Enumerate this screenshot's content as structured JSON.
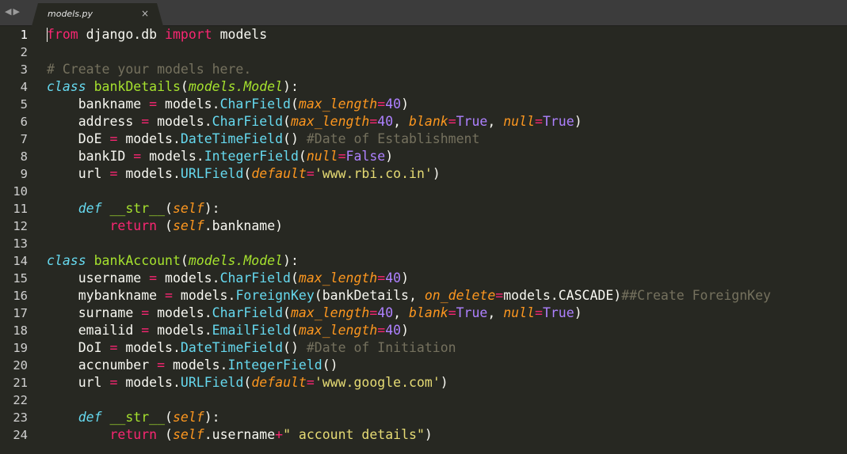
{
  "tabbar": {
    "back_arrow": "◀",
    "forward_arrow": "▶",
    "tab_title": "models.py",
    "close_glyph": "×"
  },
  "editor": {
    "current_line": 1,
    "lines": [
      [
        [
          "kw",
          "from"
        ],
        [
          "pl",
          " django.db "
        ],
        [
          "kw",
          "import"
        ],
        [
          "pl",
          " models"
        ]
      ],
      [],
      [
        [
          "cm",
          "# Create your models here."
        ]
      ],
      [
        [
          "st",
          "class"
        ],
        [
          "pl",
          " "
        ],
        [
          "cl",
          "bankDetails"
        ],
        [
          "pl",
          "("
        ],
        [
          "ih",
          "models.Model"
        ],
        [
          "pl",
          "):"
        ]
      ],
      [
        [
          "pl",
          "    bankname "
        ],
        [
          "op",
          "="
        ],
        [
          "pl",
          " models."
        ],
        [
          "fn",
          "CharField"
        ],
        [
          "pl",
          "("
        ],
        [
          "pa",
          "max_length"
        ],
        [
          "op",
          "="
        ],
        [
          "nu",
          "40"
        ],
        [
          "pl",
          ")"
        ]
      ],
      [
        [
          "pl",
          "    address "
        ],
        [
          "op",
          "="
        ],
        [
          "pl",
          " models."
        ],
        [
          "fn",
          "CharField"
        ],
        [
          "pl",
          "("
        ],
        [
          "pa",
          "max_length"
        ],
        [
          "op",
          "="
        ],
        [
          "nu",
          "40"
        ],
        [
          "pl",
          ", "
        ],
        [
          "pa",
          "blank"
        ],
        [
          "op",
          "="
        ],
        [
          "bi",
          "True"
        ],
        [
          "pl",
          ", "
        ],
        [
          "pa",
          "null"
        ],
        [
          "op",
          "="
        ],
        [
          "bi",
          "True"
        ],
        [
          "pl",
          ")"
        ]
      ],
      [
        [
          "pl",
          "    DoE "
        ],
        [
          "op",
          "="
        ],
        [
          "pl",
          " models."
        ],
        [
          "fn",
          "DateTimeField"
        ],
        [
          "pl",
          "() "
        ],
        [
          "cm",
          "#Date of Establishment"
        ]
      ],
      [
        [
          "pl",
          "    bankID "
        ],
        [
          "op",
          "="
        ],
        [
          "pl",
          " models."
        ],
        [
          "fn",
          "IntegerField"
        ],
        [
          "pl",
          "("
        ],
        [
          "pa",
          "null"
        ],
        [
          "op",
          "="
        ],
        [
          "bi",
          "False"
        ],
        [
          "pl",
          ")"
        ]
      ],
      [
        [
          "pl",
          "    url "
        ],
        [
          "op",
          "="
        ],
        [
          "pl",
          " models."
        ],
        [
          "fn",
          "URLField"
        ],
        [
          "pl",
          "("
        ],
        [
          "pa",
          "default"
        ],
        [
          "op",
          "="
        ],
        [
          "s",
          "'www.rbi.co.in'"
        ],
        [
          "pl",
          ")"
        ]
      ],
      [],
      [
        [
          "pl",
          "    "
        ],
        [
          "st",
          "def"
        ],
        [
          "pl",
          " "
        ],
        [
          "dn",
          "__str__"
        ],
        [
          "pl",
          "("
        ],
        [
          "sf",
          "self"
        ],
        [
          "pl",
          "):"
        ]
      ],
      [
        [
          "pl",
          "        "
        ],
        [
          "kw",
          "return"
        ],
        [
          "pl",
          " ("
        ],
        [
          "sf",
          "self"
        ],
        [
          "pl",
          ".bankname)"
        ]
      ],
      [],
      [
        [
          "st",
          "class"
        ],
        [
          "pl",
          " "
        ],
        [
          "cl",
          "bankAccount"
        ],
        [
          "pl",
          "("
        ],
        [
          "ih",
          "models.Model"
        ],
        [
          "pl",
          "):"
        ]
      ],
      [
        [
          "pl",
          "    username "
        ],
        [
          "op",
          "="
        ],
        [
          "pl",
          " models."
        ],
        [
          "fn",
          "CharField"
        ],
        [
          "pl",
          "("
        ],
        [
          "pa",
          "max_length"
        ],
        [
          "op",
          "="
        ],
        [
          "nu",
          "40"
        ],
        [
          "pl",
          ")"
        ]
      ],
      [
        [
          "pl",
          "    mybankname "
        ],
        [
          "op",
          "="
        ],
        [
          "pl",
          " models."
        ],
        [
          "fn",
          "ForeignKey"
        ],
        [
          "pl",
          "(bankDetails, "
        ],
        [
          "pa",
          "on_delete"
        ],
        [
          "op",
          "="
        ],
        [
          "pl",
          "models.CASCADE)"
        ],
        [
          "cm",
          "##Create ForeignKey"
        ]
      ],
      [
        [
          "pl",
          "    surname "
        ],
        [
          "op",
          "="
        ],
        [
          "pl",
          " models."
        ],
        [
          "fn",
          "CharField"
        ],
        [
          "pl",
          "("
        ],
        [
          "pa",
          "max_length"
        ],
        [
          "op",
          "="
        ],
        [
          "nu",
          "40"
        ],
        [
          "pl",
          ", "
        ],
        [
          "pa",
          "blank"
        ],
        [
          "op",
          "="
        ],
        [
          "bi",
          "True"
        ],
        [
          "pl",
          ", "
        ],
        [
          "pa",
          "null"
        ],
        [
          "op",
          "="
        ],
        [
          "bi",
          "True"
        ],
        [
          "pl",
          ")"
        ]
      ],
      [
        [
          "pl",
          "    emailid "
        ],
        [
          "op",
          "="
        ],
        [
          "pl",
          " models."
        ],
        [
          "fn",
          "EmailField"
        ],
        [
          "pl",
          "("
        ],
        [
          "pa",
          "max_length"
        ],
        [
          "op",
          "="
        ],
        [
          "nu",
          "40"
        ],
        [
          "pl",
          ")"
        ]
      ],
      [
        [
          "pl",
          "    DoI "
        ],
        [
          "op",
          "="
        ],
        [
          "pl",
          " models."
        ],
        [
          "fn",
          "DateTimeField"
        ],
        [
          "pl",
          "() "
        ],
        [
          "cm",
          "#Date of Initiation"
        ]
      ],
      [
        [
          "pl",
          "    accnumber "
        ],
        [
          "op",
          "="
        ],
        [
          "pl",
          " models."
        ],
        [
          "fn",
          "IntegerField"
        ],
        [
          "pl",
          "()"
        ]
      ],
      [
        [
          "pl",
          "    url "
        ],
        [
          "op",
          "="
        ],
        [
          "pl",
          " models."
        ],
        [
          "fn",
          "URLField"
        ],
        [
          "pl",
          "("
        ],
        [
          "pa",
          "default"
        ],
        [
          "op",
          "="
        ],
        [
          "s",
          "'www.google.com'"
        ],
        [
          "pl",
          ")"
        ]
      ],
      [],
      [
        [
          "pl",
          "    "
        ],
        [
          "st",
          "def"
        ],
        [
          "pl",
          " "
        ],
        [
          "dn",
          "__str__"
        ],
        [
          "pl",
          "("
        ],
        [
          "sf",
          "self"
        ],
        [
          "pl",
          "):"
        ]
      ],
      [
        [
          "pl",
          "        "
        ],
        [
          "kw",
          "return"
        ],
        [
          "pl",
          " ("
        ],
        [
          "sf",
          "self"
        ],
        [
          "pl",
          ".username"
        ],
        [
          "op",
          "+"
        ],
        [
          "s",
          "\" account details\""
        ],
        [
          "pl",
          ")"
        ]
      ]
    ]
  }
}
